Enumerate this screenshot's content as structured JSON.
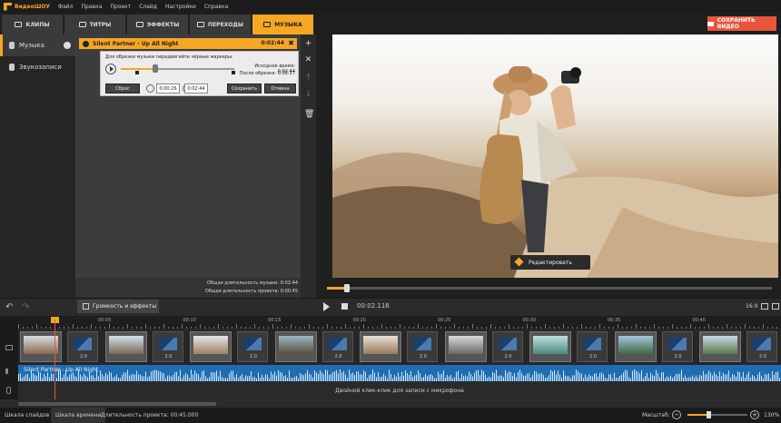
{
  "menubar": {
    "app_name": "ВидеоШОУ",
    "items": [
      "Файл",
      "Правка",
      "Проект",
      "Слайд",
      "Настройки",
      "Справка"
    ]
  },
  "tabs": [
    {
      "label": "КЛИПЫ",
      "active": false
    },
    {
      "label": "ТИТРЫ",
      "active": false
    },
    {
      "label": "ЭФФЕКТЫ",
      "active": false
    },
    {
      "label": "ПЕРЕХОДЫ",
      "active": false
    },
    {
      "label": "МУЗЫКА",
      "active": true
    }
  ],
  "save_video_label": "СОХРАНИТЬ ВИДЕО",
  "left_nav": [
    {
      "label": "Музыка",
      "active": true
    },
    {
      "label": "Звукозаписи",
      "active": false
    }
  ],
  "track": {
    "title": "Silent Partner - Up All Night",
    "duration": "0:02:44",
    "close_symbol": "✖"
  },
  "trim": {
    "hint": "Для обрезки музыки передвигайте чёрные маркеры:",
    "source_time_label": "Исходное время:",
    "source_time": "0:02:44",
    "after_trim_label": "После обрезки:",
    "after_trim": "0:02:17",
    "reset_label": "Сброс",
    "start_time": "0:00:26",
    "end_time": "0:02:44",
    "save_label": "Сохранить",
    "cancel_label": "Отмена",
    "progress": 0.3
  },
  "totals": {
    "music_label": "Общая длительность музыки:",
    "music": "0:02:44",
    "project_label": "Общая длительность проекта:",
    "project": "0:00:45"
  },
  "side_tools": [
    "+",
    "✕",
    "↑",
    "↓",
    "🗑"
  ],
  "preview": {
    "edit_label": "Редактировать",
    "scrub_progress": 0.04
  },
  "controls": {
    "volume_label": "Громкость и эффекты",
    "timecode": "00:02.116",
    "aspect": "16:9"
  },
  "ruler_labels": [
    "00:05",
    "00:10",
    "00:15",
    "00:20",
    "00:25",
    "00:30",
    "00:35",
    "00:40"
  ],
  "transition_label": "2.0",
  "audio_track_label": "Silent Partner - Up All Night",
  "mic_hint": "Двойной клик-клик для записи с микрофона",
  "status": {
    "slides_label": "Шкала слайдов",
    "timeline_label": "Шкала времени",
    "duration_label": "Длительность проекта: 00:45.000",
    "zoom_label": "Масштаб:",
    "zoom_value": "130%",
    "zoom_progress": 0.32
  }
}
